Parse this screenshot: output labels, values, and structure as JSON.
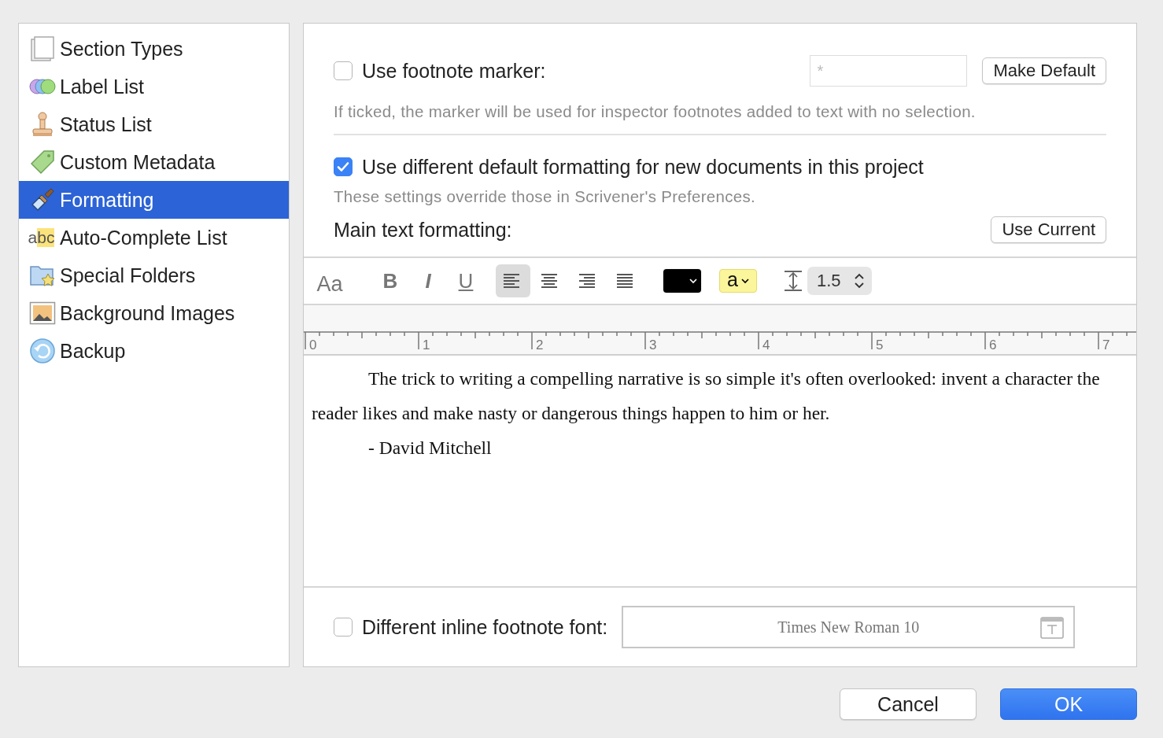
{
  "sidebar": {
    "items": [
      {
        "label": "Section Types",
        "kind": "pages",
        "selected": false
      },
      {
        "label": "Label List",
        "kind": "labels",
        "selected": false
      },
      {
        "label": "Status List",
        "kind": "stamp",
        "selected": false
      },
      {
        "label": "Custom Metadata",
        "kind": "tag",
        "selected": false
      },
      {
        "label": "Formatting",
        "kind": "brush",
        "selected": true
      },
      {
        "label": "Auto-Complete List",
        "kind": "abc",
        "icon_text": "abc",
        "selected": false
      },
      {
        "label": "Special Folders",
        "kind": "folder",
        "selected": false
      },
      {
        "label": "Background Images",
        "kind": "image",
        "selected": false
      },
      {
        "label": "Backup",
        "kind": "backup",
        "selected": false
      }
    ]
  },
  "footnote_marker": {
    "label": "Use footnote marker:",
    "checked": false,
    "placeholder": "*",
    "button": "Make Default",
    "description": "If ticked, the marker will be used for inspector footnotes added to text with no selection."
  },
  "default_formatting": {
    "label": "Use different default formatting for new documents in this project",
    "checked": true,
    "description": "These settings override those in Scrivener's Preferences."
  },
  "main_text_formatting": {
    "label": "Main text formatting:",
    "button": "Use Current"
  },
  "toolbar": {
    "font_button": "Aa",
    "bold": "B",
    "italic": "I",
    "underline": "U",
    "alignments": [
      {
        "kind": "left",
        "selected": true
      },
      {
        "kind": "center",
        "selected": false
      },
      {
        "kind": "right",
        "selected": false
      },
      {
        "kind": "justify",
        "selected": false
      }
    ],
    "highlight": {
      "label": "a",
      "color": "#fbf59b"
    },
    "line_spacing": "1.5"
  },
  "ruler": {
    "numbers": [
      "0",
      "1",
      "2",
      "3",
      "4",
      "5",
      "6",
      "7"
    ]
  },
  "sample_text": [
    "The trick to writing a compelling narrative is so simple it's often overlooked: invent a character the reader likes and make nasty or dangerous things happen to him or her.",
    "- David Mitchell"
  ],
  "inline_footnote_font": {
    "label": "Different inline footnote font:",
    "checked": false,
    "value": "Times New Roman 10"
  },
  "buttons": [
    {
      "label": "Cancel",
      "kind": "cancel"
    },
    {
      "label": "OK",
      "kind": "default"
    }
  ]
}
